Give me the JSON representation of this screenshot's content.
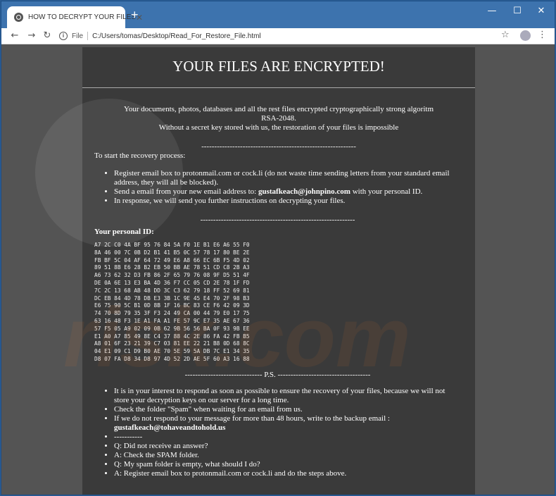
{
  "browser": {
    "tab_title": "HOW TO DECRYPT YOUR FILES",
    "url_scheme": "File",
    "url": "C:/Users/tomas/Desktop/Read_For_Restore_File.html",
    "icons": [
      "globe-icon",
      "close-icon",
      "new-tab-icon",
      "minimize-icon",
      "maximize-icon",
      "window-close-icon",
      "back-icon",
      "forward-icon",
      "reload-icon",
      "info-icon",
      "star-icon",
      "profile-icon",
      "menu-icon"
    ]
  },
  "page": {
    "headline": "YOUR FILES ARE ENCRYPTED!",
    "intro_line1": "Your documents, photos, databases and all the rest files encrypted cryptographically strong algoritm RSA-2048.",
    "intro_line2": "Without a secret key stored with us, the restoration of your files is impossible",
    "divider1": "------------------------------------------------------------",
    "recovery_heading": "To start the recovery process:",
    "steps": [
      "Register email box to protonmail.com or cock.li (do not waste time sending letters from your standard email address, they will all be blocked).",
      "Send a email from your new email address to: ",
      "In response, we will send you further instructions on decrypting your files."
    ],
    "email_primary": "gustafkeach@johnpino.com",
    "step2_suffix": " with your personal ID.",
    "divider2": "------------------------------------------------------------",
    "personal_id_label": "Your personal ID:",
    "personal_id_lines": [
      "A7 2C C0 4A BF 95 76 84 5A F0 1E B1 E6 A6 55 F0",
      "8A 46 00 7C 0B D2 B1 41 B5 0C 57 78 17 80 BE 2E",
      "FB BF 5C 04 AF 64 72 49 E6 A8 66 EC 6B F5 4D 02",
      "89 51 8B E6 28 B2 EB 50 BB AE 78 51 CD C8 2B A3",
      "A6 73 62 32 D3 FB 86 2F 65 79 76 08 9F D5 51 4F",
      "DE 0A 6E 13 E3 BA 4D 36 F7 CC 05 CD 2E 78 1F FD",
      "7C 2C 13 68 AB 48 DD 3C C3 62 79 18 FF 52 69 81",
      "DC EB 84 4D 78 DB E3 3B 1C 9E 45 E4 70 2F 98 B3",
      "E6 75 90 5C B1 0D 8B 1F 16 BC 83 CE F6 42 09 3D",
      "74 70 8D 79 35 3F F3 24 49 CA 00 44 79 E0 17 75",
      "63 16 48 F3 1E A1 FA A1 FE 57 9C E7 35 AE 67 36",
      "57 F5 05 A9 02 09 0B 62 9B 56 56 BA 0F 93 9B EE",
      "E1 A0 A7 85 49 8E C4 37 88 4C 2E 86 FA 42 FB B5",
      "A8 01 6F 23 21 39 C7 03 81 EE 22 21 B8 0D 68 8C",
      "04 E1 09 C1 D9 B0 AE 70 5E 59 5A DB 7C E1 34 35",
      "D8 07 FA D8 34 D8 97 4D 52 2D AE 5F 60 A3 16 88"
    ],
    "ps_divider": "------------------------------ P.S. ------------------------------------",
    "ps_items": [
      "It is in your interest to respond as soon as possible to ensure the recovery of your files, because we will not store your decryption keys on our server for a long time.",
      "Check the folder \"Spam\" when waiting for an email from us.",
      "If we do not respond to your message for more than 48 hours, write to the backup email : ",
      "-----------",
      "Q: Did not receive an answer?",
      "A: Check the SPAM folder.",
      "Q: My spam folder is empty, what should I do?",
      "A: Register email box to protonmail.com or cock.li and do the steps above."
    ],
    "email_backup": "gustafkeach@tohaveandtohold.us"
  }
}
